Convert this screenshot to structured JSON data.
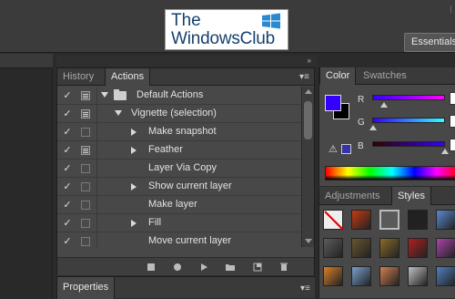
{
  "logo": {
    "line1": "The",
    "line2": "WindowsClub"
  },
  "topbar": {
    "essentials_label": "Essentials"
  },
  "actions_panel": {
    "tabs": [
      {
        "label": "History"
      },
      {
        "label": "Actions"
      }
    ],
    "active_tab": "Actions",
    "rows": [
      {
        "label": "Default Actions",
        "checked": true,
        "dialog": true,
        "type": "set",
        "expanded": true
      },
      {
        "label": "Vignette (selection)",
        "checked": true,
        "dialog": true,
        "type": "action",
        "expanded": true
      },
      {
        "label": "Make snapshot",
        "checked": true,
        "dialog": false,
        "type": "step",
        "has_children": true
      },
      {
        "label": "Feather",
        "checked": true,
        "dialog": true,
        "type": "step",
        "has_children": true
      },
      {
        "label": "Layer Via Copy",
        "checked": true,
        "dialog": false,
        "type": "step",
        "has_children": false
      },
      {
        "label": "Show current layer",
        "checked": true,
        "dialog": false,
        "type": "step",
        "has_children": true
      },
      {
        "label": "Make layer",
        "checked": true,
        "dialog": false,
        "type": "step",
        "has_children": false
      },
      {
        "label": "Fill",
        "checked": true,
        "dialog": false,
        "type": "step",
        "has_children": true
      },
      {
        "label": "Move current layer",
        "checked": true,
        "dialog": false,
        "type": "step",
        "has_children": false
      }
    ],
    "toolbar_icons": [
      "stop-icon",
      "record-icon",
      "play-icon",
      "new-set-icon",
      "new-action-icon",
      "delete-icon"
    ]
  },
  "properties_panel": {
    "tab_label": "Properties"
  },
  "color_panel": {
    "tabs": [
      {
        "label": "Color"
      },
      {
        "label": "Swatches"
      }
    ],
    "foreground": "#3300ff",
    "background": "#000000",
    "channels": [
      {
        "label": "R",
        "value_fraction": 0.2
      },
      {
        "label": "G",
        "value_fraction": 0.0
      },
      {
        "label": "B",
        "value_fraction": 1.0
      }
    ]
  },
  "styles_panel": {
    "tabs": [
      {
        "label": "Adjustments"
      },
      {
        "label": "Styles"
      }
    ],
    "styles": [
      {
        "name": "none-style",
        "color": "#e8e8e8"
      },
      {
        "name": "orange-glow-style",
        "color": "#c83a10"
      },
      {
        "name": "gray-frame-style",
        "color": "#8a8a8a"
      },
      {
        "name": "black-button-style",
        "color": "#202020"
      },
      {
        "name": "blue-glass-style",
        "color": "#5a8ad0"
      },
      {
        "name": "dark-emboss-style",
        "color": "#5c5c5c"
      },
      {
        "name": "brown-emboss-style",
        "color": "#6a5530"
      },
      {
        "name": "gold-style",
        "color": "#8a6a2a"
      },
      {
        "name": "red-style",
        "color": "#b02020"
      },
      {
        "name": "rainbow-style",
        "color": "#aa44aa"
      },
      {
        "name": "orange-gradient-style",
        "color": "#d8802a"
      },
      {
        "name": "sky-style",
        "color": "#7aa0d0"
      },
      {
        "name": "sunset-style",
        "color": "#d08050"
      },
      {
        "name": "lace-style",
        "color": "#c0c0c0"
      },
      {
        "name": "color-mix-style",
        "color": "#5080c0"
      }
    ]
  }
}
